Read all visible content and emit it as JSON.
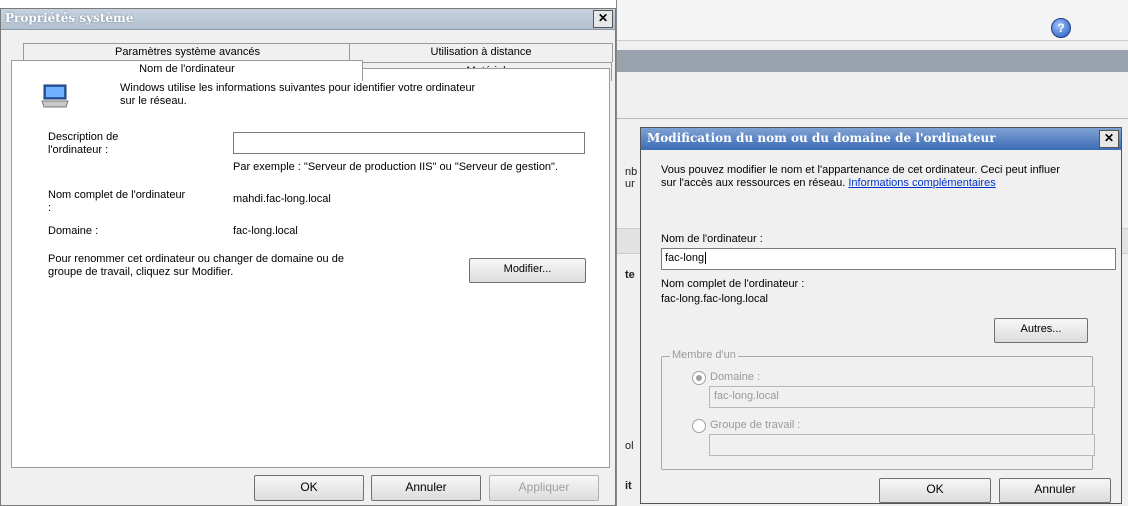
{
  "left_dialog": {
    "title": "Propriétés système",
    "close": "✕",
    "tabs": {
      "row1": [
        "Paramètres système avancés",
        "Utilisation à distance"
      ],
      "row2": [
        "Nom de l'ordinateur",
        "Matériel"
      ]
    },
    "intro": "Windows utilise les informations suivantes pour identifier votre ordinateur sur le réseau.",
    "description_label": "Description de l'ordinateur :",
    "description_value": "",
    "example": "Par exemple : \"Serveur de production IIS\" ou \"Serveur de gestion\".",
    "full_name_label": "Nom complet de l'ordinateur :",
    "full_name_value": "mahdi.fac-long.local",
    "domain_label": "Domaine :",
    "domain_value": "fac-long.local",
    "rename_text": "Pour renommer cet ordinateur ou changer de domaine ou de groupe de travail, cliquez sur Modifier.",
    "modify_button": "Modifier...",
    "ok_button": "OK",
    "cancel_button": "Annuler",
    "apply_button": "Appliquer"
  },
  "right_dialog": {
    "title": "Modification du nom ou du domaine de l'ordinateur",
    "close": "✕",
    "intro": "Vous pouvez modifier le nom et l'appartenance de cet ordinateur. Ceci peut influer sur l'accès aux ressources en réseau.",
    "more_info_link": "Informations complémentaires",
    "computer_name_label": "Nom de l'ordinateur :",
    "computer_name_value": "fac-long",
    "full_name_label": "Nom complet de l'ordinateur :",
    "full_name_value": "fac-long.fac-long.local",
    "others_button": "Autres...",
    "member_of_label": "Membre d'un",
    "domain_radio_label": "Domaine :",
    "domain_value": "fac-long.local",
    "workgroup_radio_label": "Groupe de travail :",
    "workgroup_value": "",
    "ok_button": "OK",
    "cancel_button": "Annuler"
  },
  "background_window": {
    "help_icon": "?",
    "fragments": [
      "nb",
      "ur",
      "te",
      "ol",
      "it"
    ]
  }
}
